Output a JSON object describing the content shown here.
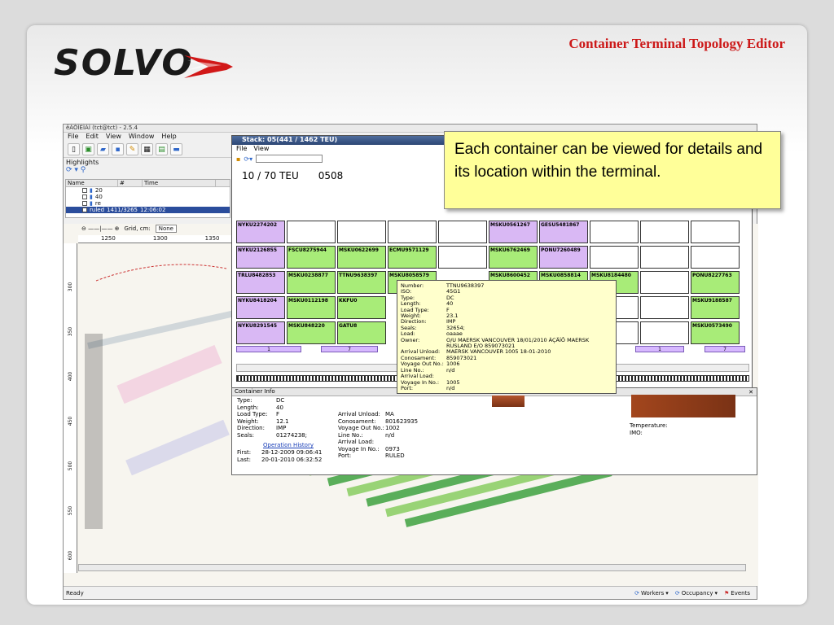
{
  "slide": {
    "title": "Container Terminal Topology Editor",
    "logo_text": "SOLVO"
  },
  "app": {
    "title": "êÀÒÌÉÌÁÌ (tct@tct) - 2.5.4",
    "menu": [
      "File",
      "Edit",
      "View",
      "Window",
      "Help"
    ],
    "highlights_label": "Highlights",
    "columns": [
      "Name",
      "#",
      "Time"
    ],
    "highlights": [
      {
        "name": "20",
        "count": "",
        "time": ""
      },
      {
        "name": "40",
        "count": "",
        "time": ""
      },
      {
        "name": "re",
        "count": "",
        "time": ""
      },
      {
        "name": "ruled",
        "count": "1411/3265",
        "time": "12:06:02"
      }
    ],
    "grid_label": "Grid, cm:",
    "grid_value": "None",
    "ruler_ticks": [
      "1250",
      "1300",
      "1350"
    ],
    "side_ticks": [
      "300",
      "350",
      "400",
      "450",
      "500",
      "550",
      "600"
    ],
    "status": "Ready",
    "status_buttons": [
      "Workers",
      "Occupancy",
      "Events"
    ]
  },
  "stack": {
    "title": "Stack: 05(441 / 1462 TEU)",
    "menu": [
      "File",
      "View"
    ],
    "teu": "10 / 70 TEU",
    "bay": "0508",
    "nav_labels": [
      "1",
      "7",
      "1",
      "7"
    ],
    "cells": [
      {
        "id": "NYKU2274202",
        "color": "p"
      },
      {
        "id": "MSKU0561267",
        "color": "p"
      },
      {
        "id": "GESU5481867",
        "color": "p"
      },
      {
        "id": "NYKU2126855",
        "color": "p"
      },
      {
        "id": "FSCU8275944",
        "color": "g"
      },
      {
        "id": "MSKU0622699",
        "color": "g"
      },
      {
        "id": "ECMU9571129",
        "color": "g"
      },
      {
        "id": "MSKU6762469",
        "color": "g"
      },
      {
        "id": "PONU7260489",
        "color": "p"
      },
      {
        "id": "TRLU8482853",
        "color": "p"
      },
      {
        "id": "MSKU0238877",
        "color": "g"
      },
      {
        "id": "TTNU9638397",
        "color": "g"
      },
      {
        "id": "MSKU8058579",
        "color": "g"
      },
      {
        "id": "MSKU8600452",
        "color": "g"
      },
      {
        "id": "MSKU0858814",
        "color": "g"
      },
      {
        "id": "MSKU8184480",
        "color": "g"
      },
      {
        "id": "PONU8227763",
        "color": "g"
      },
      {
        "id": "NYKU8418204",
        "color": "p"
      },
      {
        "id": "MSKU0112198",
        "color": "g"
      },
      {
        "id": "KKFU0",
        "color": "g"
      },
      {
        "id": "MSKU9188587",
        "color": "g"
      },
      {
        "id": "NYKU8291545",
        "color": "p"
      },
      {
        "id": "MSKU848220",
        "color": "g"
      },
      {
        "id": "GATU8",
        "color": "g"
      },
      {
        "id": "MSKU0573490",
        "color": "g"
      }
    ]
  },
  "tooltip": {
    "rows": [
      [
        "Number:",
        "TTNU9638397"
      ],
      [
        "ISO:",
        "45G1"
      ],
      [
        "Type:",
        "DC"
      ],
      [
        "Length:",
        "40"
      ],
      [
        "Load Type:",
        "F"
      ],
      [
        "Weight:",
        "23.1"
      ],
      [
        "Direction:",
        "IMP"
      ],
      [
        "Seals:",
        "32654;"
      ],
      [
        "Load:",
        "oaaae"
      ],
      [
        "Owner:",
        "O/U MAERSK VANCOUVER 18/01/2010 ÁÇÄÍÔ MAERSK RUSLAND E/O 859073021"
      ],
      [
        "Arrival Unload:",
        "MAERSK VANCOUVER 1005 18-01-2010"
      ],
      [
        "Conosament:",
        "859073021"
      ],
      [
        "Voyage Out No.:",
        "1006"
      ],
      [
        "Line No.:",
        "n/d"
      ],
      [
        "Arrival Load:",
        ""
      ],
      [
        "Voyage In No.:",
        "1005"
      ],
      [
        "Port:",
        "n/d"
      ]
    ]
  },
  "container_info": {
    "title": "Container Info",
    "left": [
      [
        "Type:",
        "DC"
      ],
      [
        "Length:",
        "40"
      ],
      [
        "Load Type:",
        "F"
      ],
      [
        "Weight:",
        "12.1"
      ],
      [
        "Direction:",
        "IMP"
      ],
      [
        "Seals:",
        "01274238;"
      ]
    ],
    "op_history": "Operation History",
    "first_label": "First:",
    "first_value": "28-12-2009 09:06:41",
    "last_label": "Last:",
    "last_value": "20-01-2010 06:32:52",
    "mid": [
      [
        "Arrival Unload:",
        "MA"
      ],
      [
        "Conosament:",
        "801623935"
      ],
      [
        "Voyage Out No.:",
        "1002"
      ],
      [
        "Line No.:",
        "n/d"
      ],
      [
        "Arrival Load:",
        ""
      ],
      [
        "Voyage In No.:",
        "0973"
      ],
      [
        "Port:",
        "RULED"
      ]
    ],
    "right": [
      [
        "Temperature:",
        ""
      ],
      [
        "IMO:",
        ""
      ]
    ]
  },
  "callout": "Each container can be viewed for details and its location within the terminal."
}
